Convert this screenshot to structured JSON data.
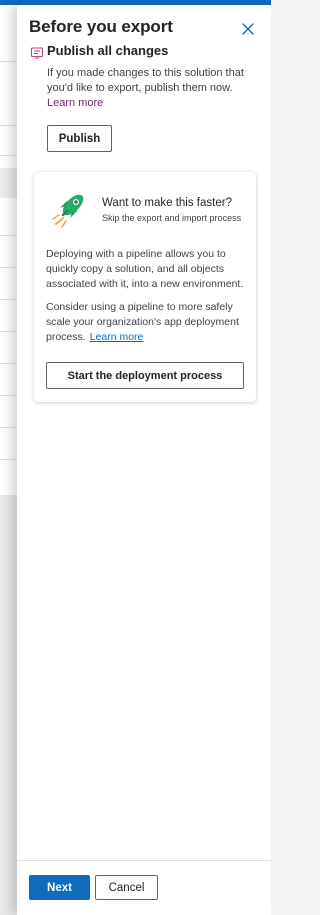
{
  "colors": {
    "accent": "#0f6cbd",
    "inline_link": "#742774",
    "rocket_green": "#27a96b",
    "panel_bg": "#ffffff"
  },
  "panel": {
    "title": "Before you export",
    "close_icon": "close-icon"
  },
  "publish_section": {
    "icon": "publish-document-icon",
    "heading": "Publish all changes",
    "description": "If you made changes to this solution that you'd like to export, publish them now.",
    "learn_more": "Learn more",
    "button_label": "Publish"
  },
  "pipeline_card": {
    "icon": "rocket-icon",
    "heading": "Want to make this faster?",
    "subheading": "Skip the export and import process",
    "paragraph1": "Deploying with a pipeline allows you to quickly copy a solution, and all objects associated with it, into a new environment.",
    "paragraph2": "Consider using a pipeline to more safely scale your organization's app deployment process.",
    "learn_more": "Learn more",
    "button_label": "Start the deployment process"
  },
  "footer": {
    "next_label": "Next",
    "cancel_label": "Cancel"
  }
}
